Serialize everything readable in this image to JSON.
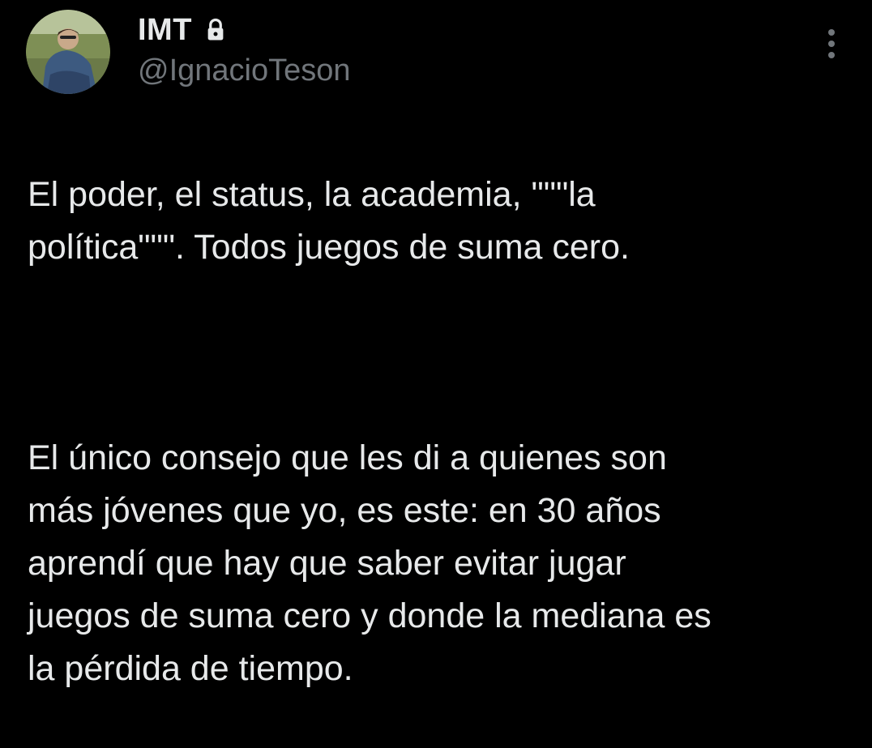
{
  "tweet": {
    "author": {
      "display_name": "IMT",
      "handle": "@IgnacioTeson",
      "protected_icon": "lock-icon",
      "avatar": "avatar"
    },
    "menu_icon": "more-vertical-icon",
    "paragraphs": [
      "El poder, el status, la academia, \"\"\"la\npolítica\"\"\". Todos juegos de suma cero.",
      "El único consejo que les di a quienes son\nmás jóvenes que yo, es este: en 30 años\naprendí que hay que saber evitar jugar\njuegos de suma cero y donde la mediana es\nla pérdida de tiempo."
    ]
  },
  "colors": {
    "background": "#000000",
    "primary_text": "#e7e9ea",
    "secondary_text": "#71767b"
  }
}
